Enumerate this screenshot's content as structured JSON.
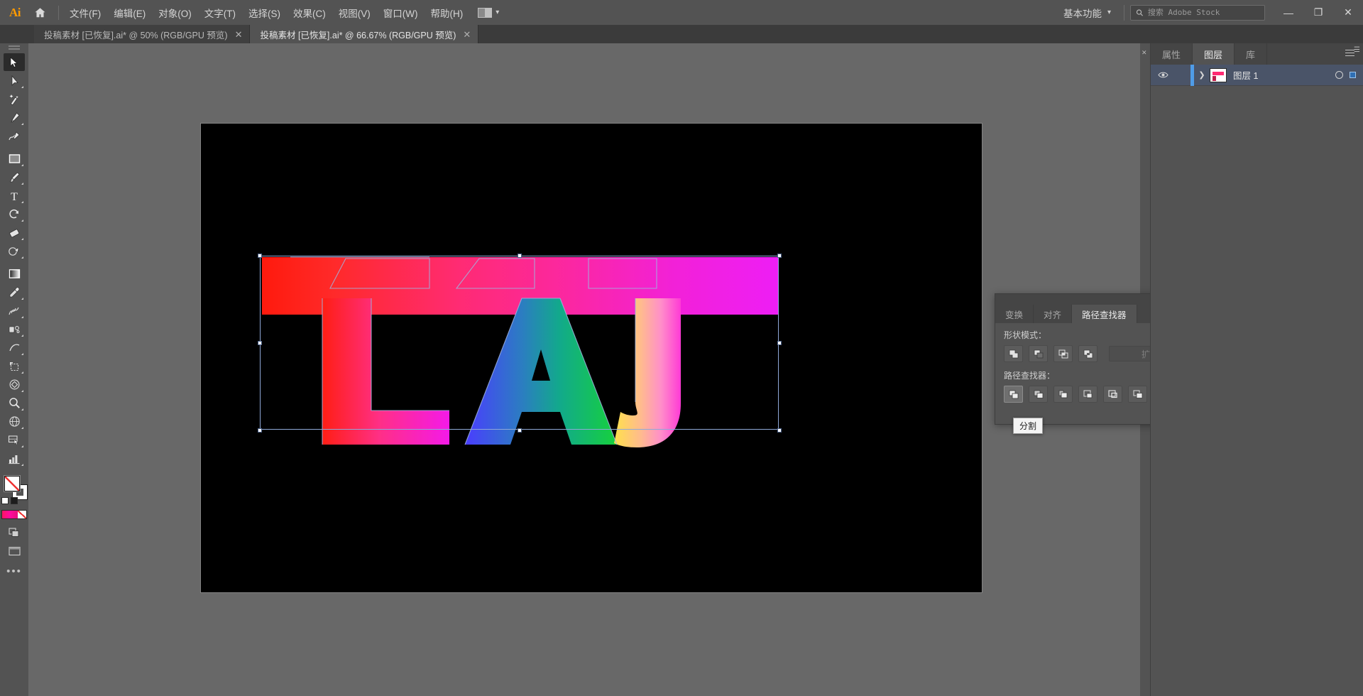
{
  "app": {
    "name": "Adobe Illustrator",
    "logo_text": "Ai"
  },
  "menubar": {
    "home_icon": "home-icon",
    "items": [
      {
        "label": "文件(F)",
        "name": "file"
      },
      {
        "label": "编辑(E)",
        "name": "edit"
      },
      {
        "label": "对象(O)",
        "name": "object"
      },
      {
        "label": "文字(T)",
        "name": "type"
      },
      {
        "label": "选择(S)",
        "name": "select"
      },
      {
        "label": "效果(C)",
        "name": "effect"
      },
      {
        "label": "视图(V)",
        "name": "view"
      },
      {
        "label": "窗口(W)",
        "name": "window"
      },
      {
        "label": "帮助(H)",
        "name": "help"
      }
    ],
    "arrange_documents_icon": "arrange-documents-icon",
    "arrange_chevron": "▾",
    "workspace": {
      "label": "基本功能",
      "chevron": "▾"
    },
    "search": {
      "icon": "search-icon",
      "placeholder": "搜索 Adobe Stock",
      "value": ""
    },
    "window_controls": {
      "minimize": "—",
      "restore": "❐",
      "close": "✕"
    }
  },
  "tabs": [
    {
      "title": "投稿素材 [已恢复].ai* @ 50% (RGB/GPU 预览)",
      "active": false,
      "close": "✕"
    },
    {
      "title": "投稿素材 [已恢复].ai* @ 66.67% (RGB/GPU 预览)",
      "active": true,
      "close": "✕"
    }
  ],
  "toolbar": {
    "tools": [
      {
        "name": "selection-tool",
        "selected": true,
        "has_flyout": false
      },
      {
        "name": "direct-selection-tool",
        "selected": false,
        "has_flyout": true
      },
      {
        "name": "magic-wand-tool",
        "selected": false,
        "has_flyout": false
      },
      {
        "name": "pen-tool",
        "selected": false,
        "has_flyout": true
      },
      {
        "name": "curvature-tool",
        "selected": false,
        "has_flyout": false
      },
      {
        "name": "rectangle-tool",
        "selected": false,
        "has_flyout": true
      },
      {
        "name": "paintbrush-tool",
        "selected": false,
        "has_flyout": true
      },
      {
        "name": "type-tool",
        "selected": false,
        "has_flyout": true
      },
      {
        "name": "rotate-tool",
        "selected": false,
        "has_flyout": true
      },
      {
        "name": "eraser-tool",
        "selected": false,
        "has_flyout": true
      },
      {
        "name": "shape-builder-tool",
        "selected": false,
        "has_flyout": true
      },
      {
        "name": "gradient-tool",
        "selected": false,
        "has_flyout": false
      },
      {
        "name": "eyedropper-tool",
        "selected": false,
        "has_flyout": true
      },
      {
        "name": "blend-tool",
        "selected": false,
        "has_flyout": true
      },
      {
        "name": "symbol-sprayer-tool",
        "selected": false,
        "has_flyout": true
      },
      {
        "name": "line-segment-tool",
        "selected": false,
        "has_flyout": true
      },
      {
        "name": "artboard-tool",
        "selected": false,
        "has_flyout": true
      },
      {
        "name": "free-transform-tool",
        "selected": false,
        "has_flyout": true
      },
      {
        "name": "zoom-tool",
        "selected": false,
        "has_flyout": true
      },
      {
        "name": "perspective-grid-tool",
        "selected": false,
        "has_flyout": true
      },
      {
        "name": "slice-tool",
        "selected": false,
        "has_flyout": true
      },
      {
        "name": "column-graph-tool",
        "selected": false,
        "has_flyout": true
      }
    ],
    "more_tools_icon": "more-tools-ellipsis",
    "more_tools_label": "•••",
    "fill_color": "#ffffff",
    "stroke_color": "#ffffff",
    "gradient_colors": [
      "#ff1464",
      "#ff0aa0",
      "#e60e7a"
    ]
  },
  "canvas": {
    "background_color": "#686868",
    "artboard_color": "#000000",
    "artwork": {
      "letters": [
        "L",
        "A",
        "J"
      ],
      "band_gradient": [
        "#ff1a0d",
        "#ff2b73",
        "#ee1ef5"
      ],
      "letter_gradients": {
        "L": [
          "#ff1e14",
          "#ff2f86",
          "#f41ae8"
        ],
        "A": [
          "#4040ff",
          "#1e8ab4",
          "#16d13c"
        ],
        "J": [
          "#ffe14a",
          "#ffb3a0",
          "#ff4ad2"
        ]
      }
    },
    "selection_color": "#8fa8d8"
  },
  "pathfinder_panel": {
    "collapse_icon": "collapse-icon",
    "close_icon": "close-icon",
    "menu_icon": "panel-menu-icon",
    "tabs": [
      {
        "label": "变换",
        "active": false
      },
      {
        "label": "对齐",
        "active": false
      },
      {
        "label": "路径查找器",
        "active": true
      }
    ],
    "shape_modes_label": "形状模式：",
    "shape_mode_buttons": [
      {
        "name": "unite-button"
      },
      {
        "name": "minus-front-button"
      },
      {
        "name": "intersect-button"
      },
      {
        "name": "exclude-button"
      }
    ],
    "expand_label": "扩展",
    "expand_enabled": false,
    "pathfinders_label": "路径查找器：",
    "pathfinder_buttons": [
      {
        "name": "divide-button",
        "active": true
      },
      {
        "name": "trim-button",
        "active": false
      },
      {
        "name": "merge-button",
        "active": false
      },
      {
        "name": "crop-button",
        "active": false
      },
      {
        "name": "outline-button",
        "active": false
      },
      {
        "name": "minus-back-button",
        "active": false
      }
    ],
    "tooltip": "分割"
  },
  "right_panel": {
    "tabs": [
      {
        "label": "属性",
        "active": false
      },
      {
        "label": "图层",
        "active": true
      },
      {
        "label": "库",
        "active": false
      }
    ],
    "menu_icon": "panel-menu-icon",
    "collapse_icon": "collapse-icon",
    "layers": [
      {
        "name": "图层 1",
        "visible": true,
        "selected": true,
        "color": "#4f9ce8",
        "eye_icon": "eye-icon",
        "expand_icon": "chevron-right-icon",
        "target_icon": "target-ring-icon",
        "select_icon": "selected-square-icon"
      }
    ]
  }
}
